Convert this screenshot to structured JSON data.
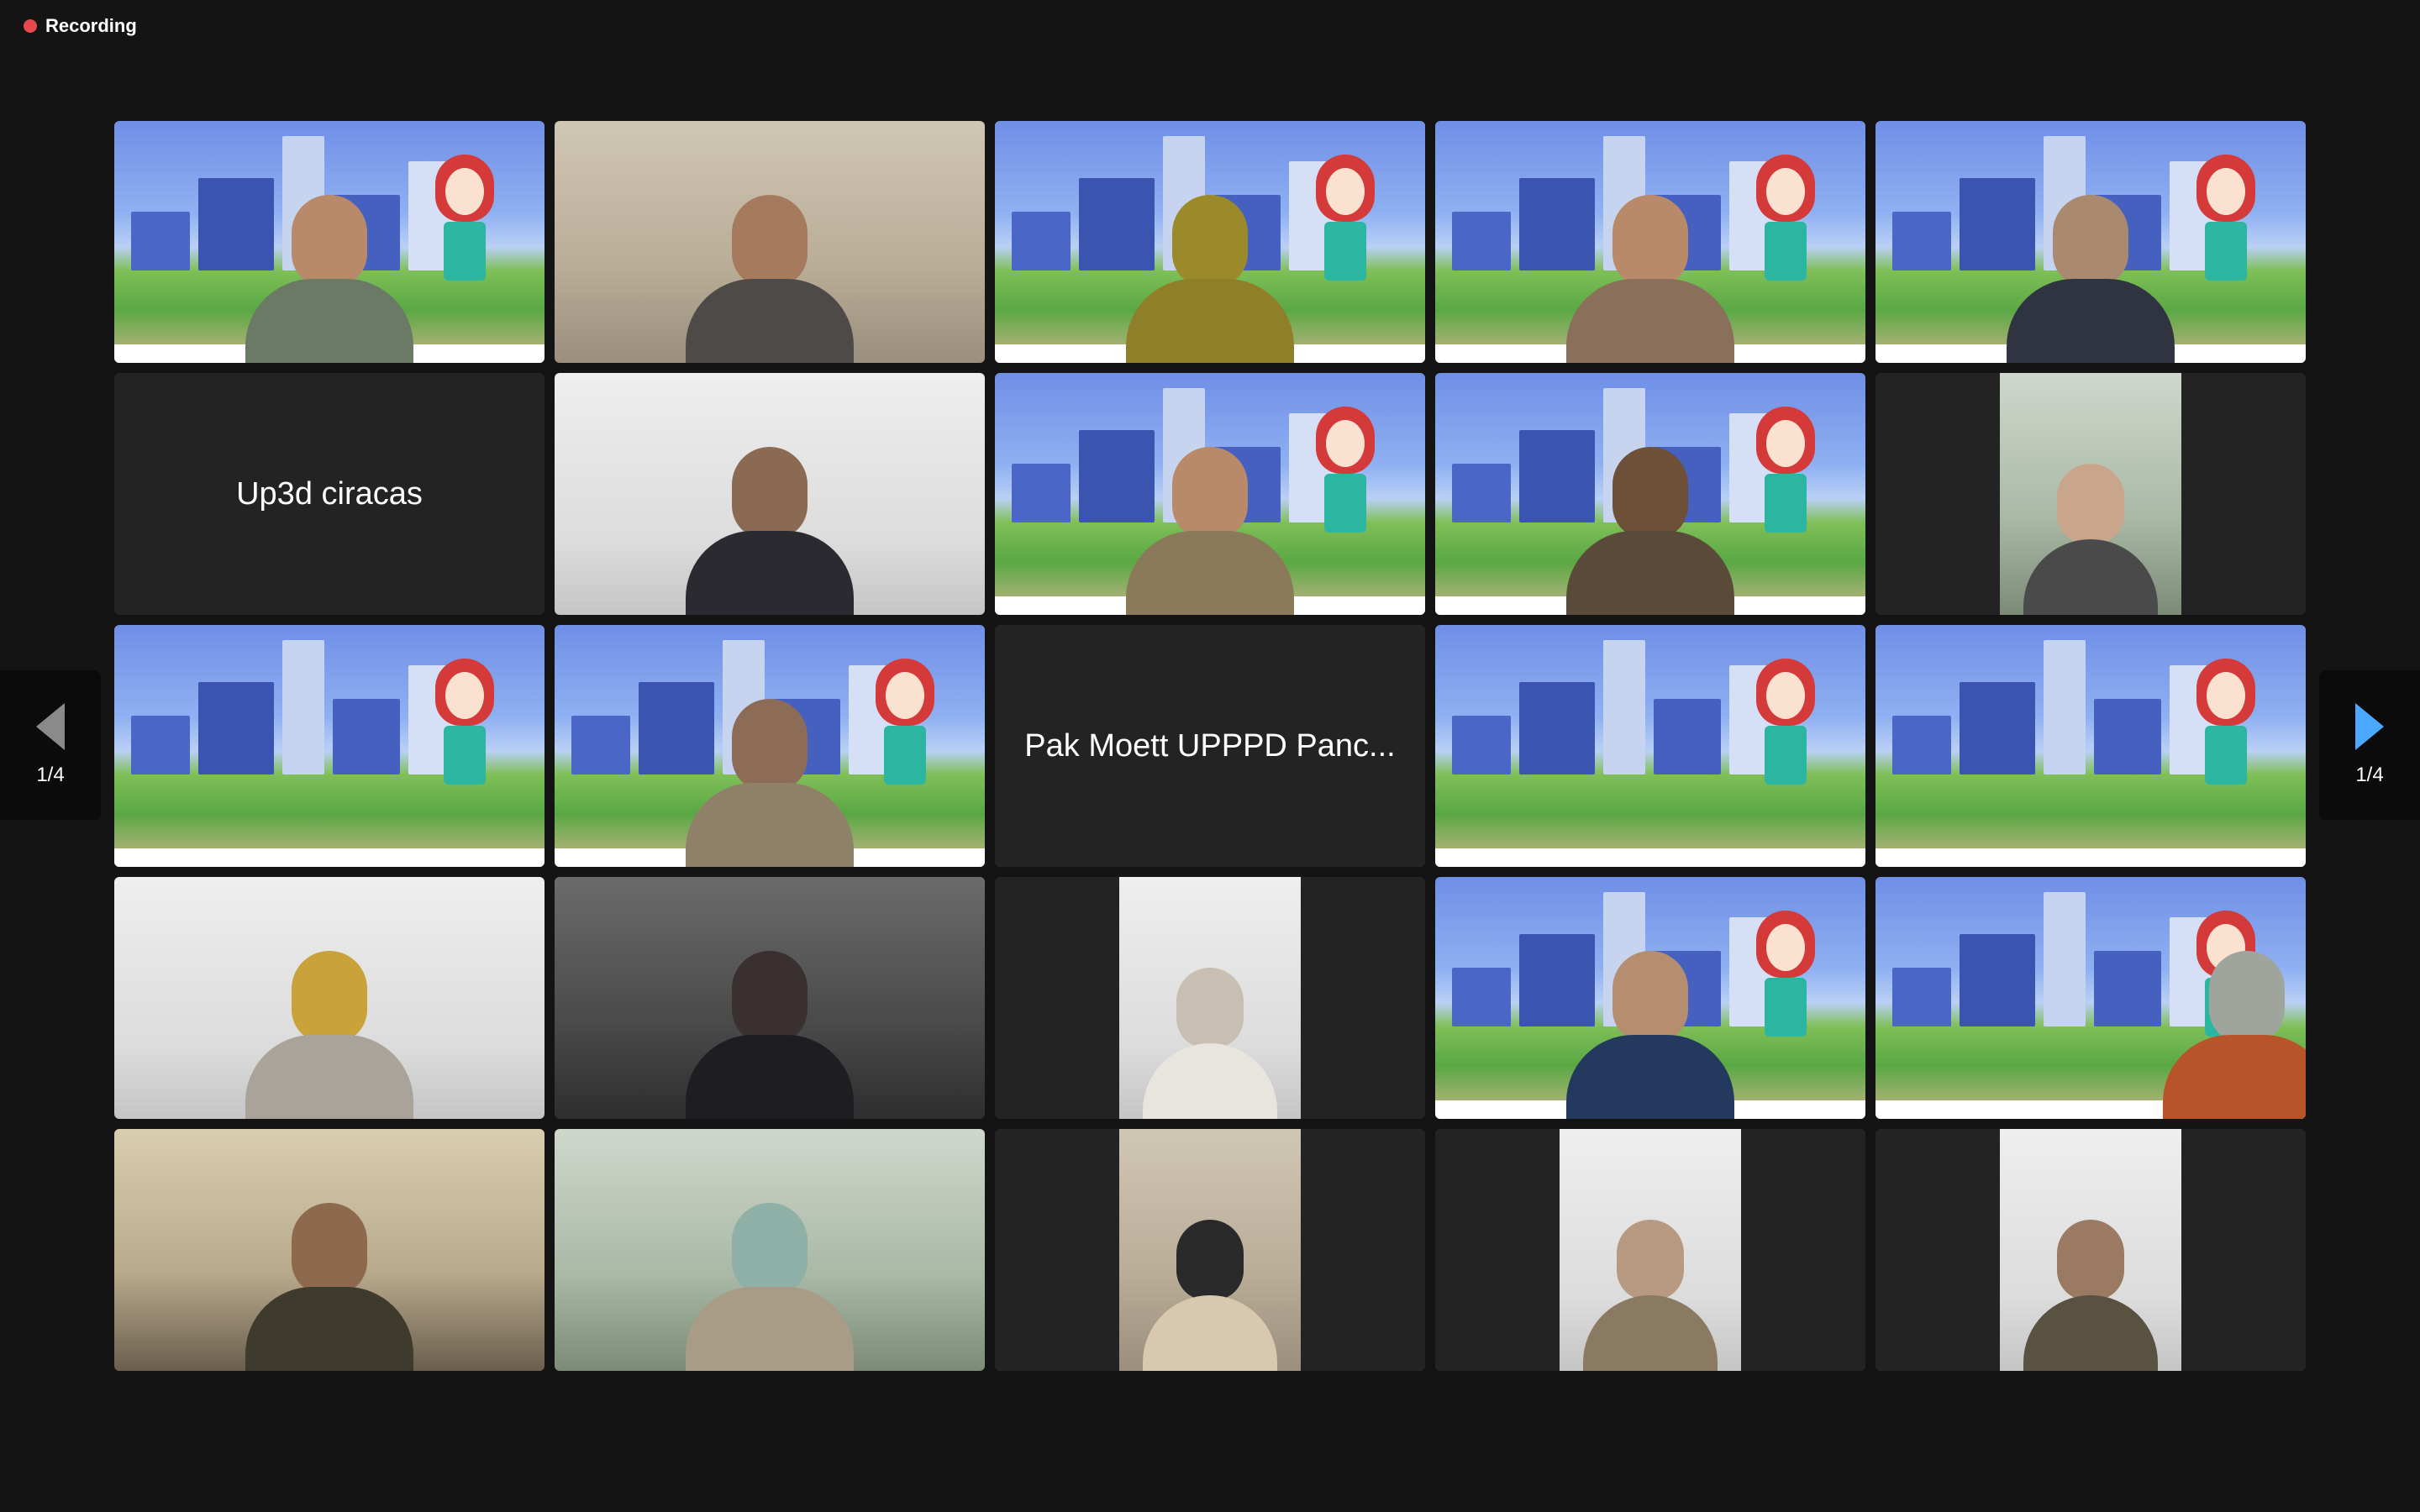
{
  "status": {
    "recording_label": "Recording",
    "recording_color": "#e5484d"
  },
  "pagination": {
    "left_label": "1/4",
    "right_label": "1/4",
    "left_icon": "triangle-left-icon",
    "right_icon": "triangle-right-icon",
    "right_icon_color": "#4aa8ff"
  },
  "gallery": {
    "active_speaker_border_color": "#3fce4b",
    "tiles": [
      {
        "kind": "virtual-bg"
      },
      {
        "kind": "camera"
      },
      {
        "kind": "virtual-bg",
        "active": true
      },
      {
        "kind": "virtual-bg"
      },
      {
        "kind": "virtual-bg"
      },
      {
        "kind": "name",
        "name": "Up3d ciracas"
      },
      {
        "kind": "camera"
      },
      {
        "kind": "virtual-bg"
      },
      {
        "kind": "virtual-bg"
      },
      {
        "kind": "camera-narrow"
      },
      {
        "kind": "virtual-bg"
      },
      {
        "kind": "virtual-bg"
      },
      {
        "kind": "name",
        "name": "Pak Moett UPPPD  Panc..."
      },
      {
        "kind": "virtual-bg"
      },
      {
        "kind": "virtual-bg"
      },
      {
        "kind": "camera"
      },
      {
        "kind": "camera"
      },
      {
        "kind": "camera-narrow"
      },
      {
        "kind": "virtual-bg"
      },
      {
        "kind": "virtual-bg"
      },
      {
        "kind": "camera"
      },
      {
        "kind": "camera"
      },
      {
        "kind": "camera-narrow"
      },
      {
        "kind": "camera-narrow"
      },
      {
        "kind": "camera-narrow"
      }
    ]
  }
}
